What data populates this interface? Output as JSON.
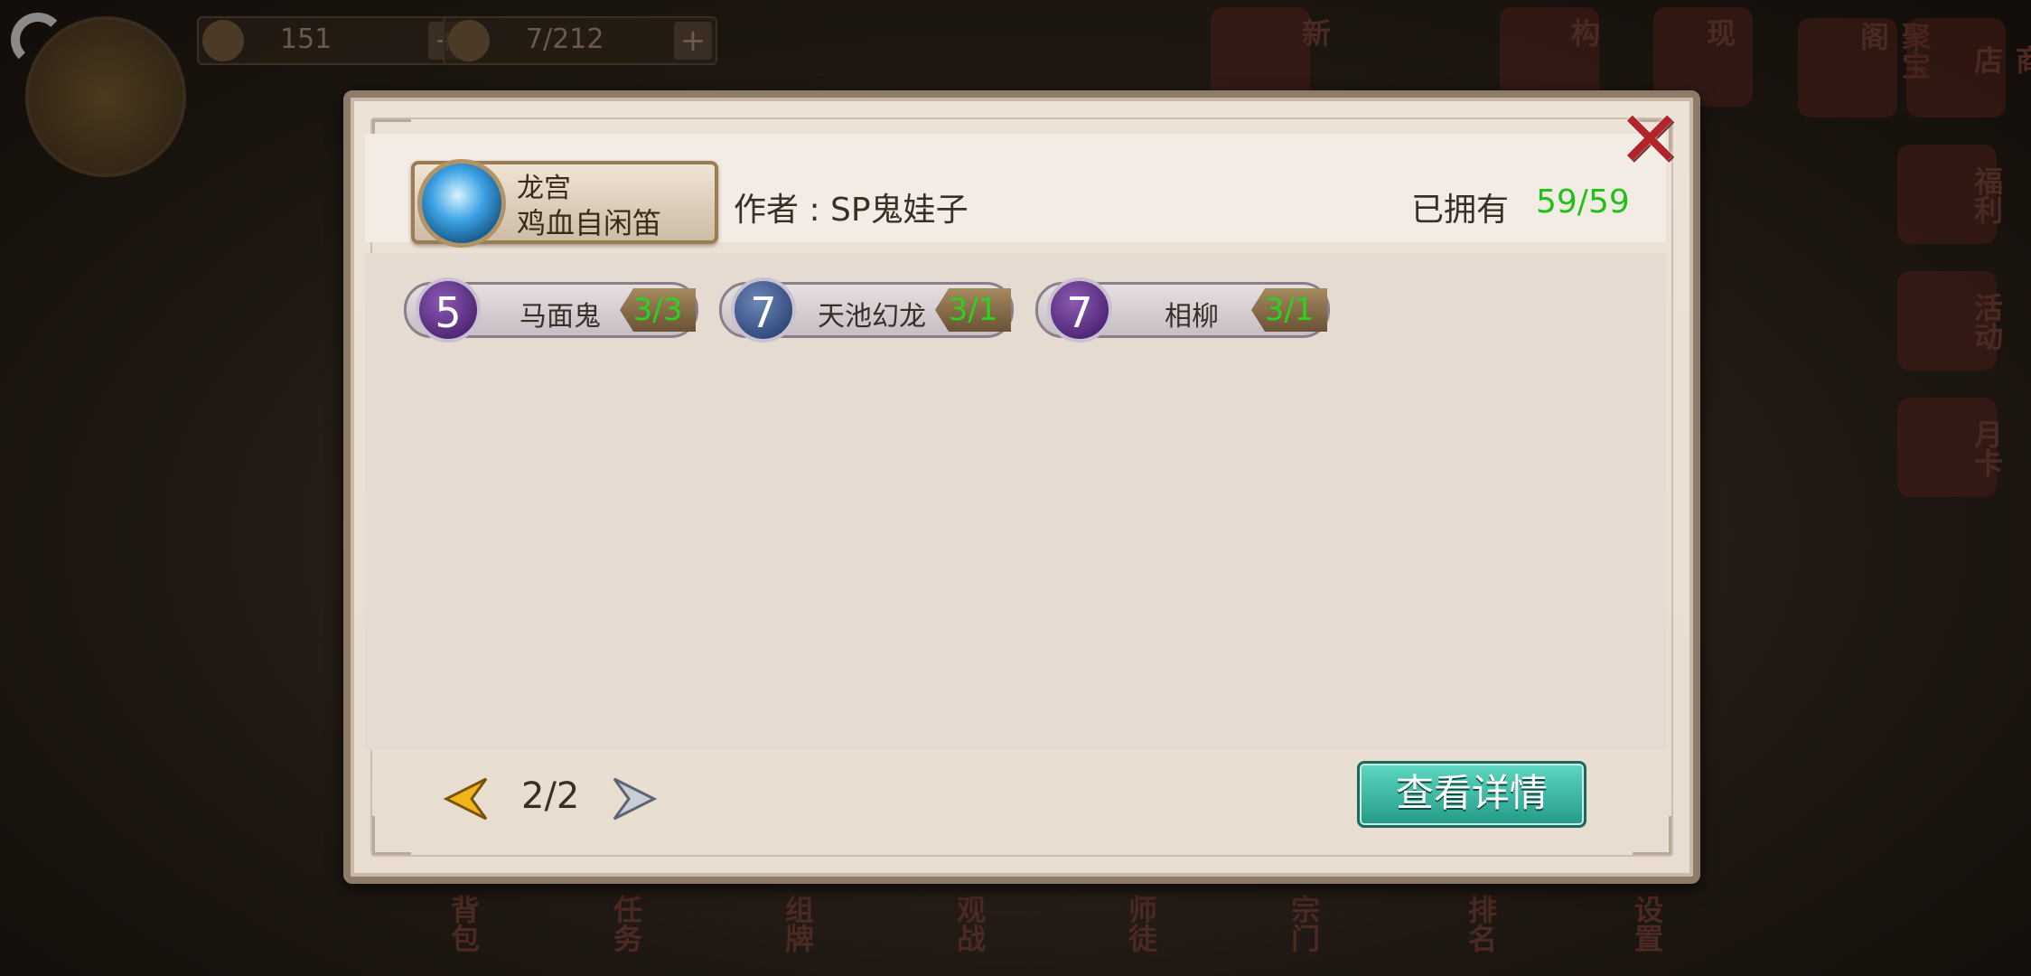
{
  "background": {
    "resources": [
      {
        "value": "151"
      },
      {
        "value": "7/212"
      }
    ],
    "plus_label": "+",
    "top_menu": [
      "新",
      "构",
      "现",
      "聚宝阁",
      "商店"
    ],
    "side_menu": [
      "福利",
      "活动",
      "月卡"
    ],
    "bottom_menu": [
      "背包",
      "任务",
      "组牌",
      "观战",
      "师徒",
      "宗门",
      "排名",
      "设置"
    ]
  },
  "dialog": {
    "close_label": "✕",
    "deck": {
      "line1": "龙宫",
      "line2": "鸡血自闲笛",
      "icon": "dragon-avatar-icon"
    },
    "author": "作者 : SP鬼娃子",
    "owned_label": "已拥有",
    "owned_value": "59/59",
    "cards": [
      {
        "cost": "5",
        "name": "马面鬼",
        "count": "3/3",
        "orb": "purple"
      },
      {
        "cost": "7",
        "name": "天池幻龙",
        "count": "3/1",
        "orb": "blue"
      },
      {
        "cost": "7",
        "name": "相柳",
        "count": "3/1",
        "orb": "purple"
      }
    ],
    "pagination": {
      "text": "2/2"
    },
    "detail_button": "查看详情"
  },
  "colors": {
    "accent_green": "#22c01a",
    "close_red": "#b3232a",
    "button_teal": "#239a86"
  }
}
